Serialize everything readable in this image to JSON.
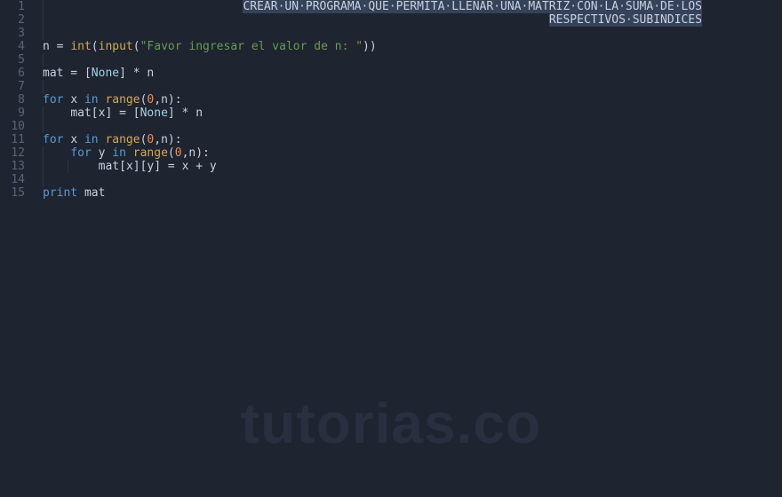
{
  "editor": {
    "total_lines": 15,
    "watermark": "tutorias.co",
    "lines": {
      "1": {
        "comment_selected": "CREAR·UN·PROGRAMA·QUE·PERMITA·LLENAR·UNA·MATRIZ·CON·LA·SUMA·DE·LOS"
      },
      "2": {
        "comment_selected": "RESPECTIVOS·SUBINDICES"
      },
      "4": {
        "ident1": "n",
        "builtin1": "int",
        "builtin2": "input",
        "str": "\"Favor ingresar el valor de n: \""
      },
      "6": {
        "ident1": "mat",
        "const1": "None",
        "ident2": "n"
      },
      "8": {
        "kw1": "for",
        "ident1": "x",
        "kw2": "in",
        "builtin1": "range",
        "num1": "0",
        "ident2": "n"
      },
      "9": {
        "ident1": "mat",
        "ident2": "x",
        "const1": "None",
        "ident3": "n"
      },
      "11": {
        "kw1": "for",
        "ident1": "x",
        "kw2": "in",
        "builtin1": "range",
        "num1": "0",
        "ident2": "n"
      },
      "12": {
        "kw1": "for",
        "ident1": "y",
        "kw2": "in",
        "builtin1": "range",
        "num1": "0",
        "ident2": "n"
      },
      "13": {
        "ident1": "mat",
        "ident2": "x",
        "ident3": "y",
        "ident4": "x",
        "ident5": "y"
      },
      "15": {
        "kw1": "print",
        "ident1": "mat"
      }
    }
  }
}
